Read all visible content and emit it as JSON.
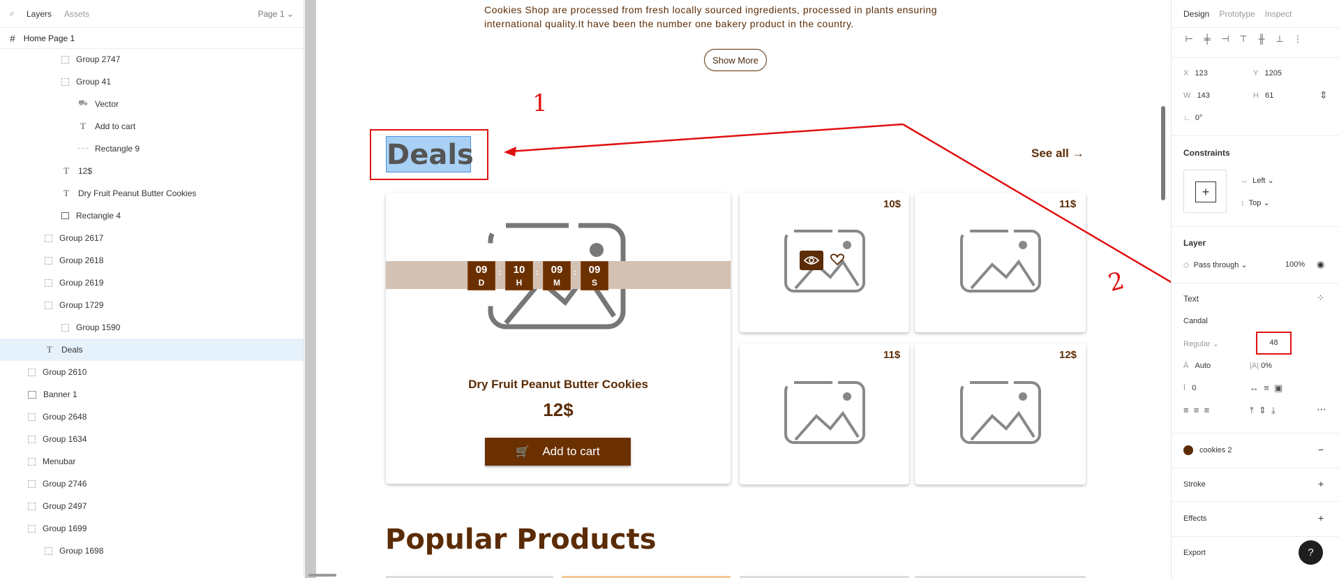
{
  "left_panel": {
    "tabs": {
      "layers": "Layers",
      "assets": "Assets",
      "page": "Page 1 ⌄"
    },
    "page_row": "Home Page 1",
    "layers": [
      {
        "label": "Group 2747",
        "kind": "group",
        "indent": 2
      },
      {
        "label": "Group 41",
        "kind": "group",
        "indent": 2
      },
      {
        "label": "Vector",
        "kind": "vector",
        "indent": 3
      },
      {
        "label": "Add to cart",
        "kind": "text",
        "indent": 3
      },
      {
        "label": "Rectangle 9",
        "kind": "rect9",
        "indent": 3
      },
      {
        "label": "12$",
        "kind": "text",
        "indent": 2
      },
      {
        "label": "Dry Fruit Peanut Butter Cookies",
        "kind": "text",
        "indent": 2
      },
      {
        "label": "Rectangle 4",
        "kind": "rect",
        "indent": 2
      },
      {
        "label": "Group 2617",
        "kind": "group",
        "indent": 1
      },
      {
        "label": "Group 2618",
        "kind": "group",
        "indent": 1
      },
      {
        "label": "Group 2619",
        "kind": "group",
        "indent": 1
      },
      {
        "label": "Group 1729",
        "kind": "group",
        "indent": 1
      },
      {
        "label": "Group 1590",
        "kind": "group",
        "indent": 2
      },
      {
        "label": "Deals",
        "kind": "text",
        "indent": 1,
        "selected": true
      },
      {
        "label": "Group 2610",
        "kind": "group",
        "indent": 0
      },
      {
        "label": "Banner 1",
        "kind": "image",
        "indent": 0
      },
      {
        "label": "Group 2648",
        "kind": "group",
        "indent": 0
      },
      {
        "label": "Group 1634",
        "kind": "group",
        "indent": 0
      },
      {
        "label": "Menubar",
        "kind": "group",
        "indent": 0
      },
      {
        "label": "Group 2746",
        "kind": "group",
        "indent": 0
      },
      {
        "label": "Group 2497",
        "kind": "group",
        "indent": 0
      },
      {
        "label": "Group 1699",
        "kind": "group",
        "indent": 0
      },
      {
        "label": "Group 1698",
        "kind": "group",
        "indent": 1
      }
    ]
  },
  "canvas": {
    "intro_text": "Cookies Shop are processed from fresh locally sourced ingredients, processed in plants ensuring international quality.It have been the number one bakery product in the country.",
    "show_more": "Show More",
    "deals_title": "Deals",
    "see_all": "See all →",
    "featured": {
      "name": "Dry Fruit Peanut Butter Cookies",
      "price": "12$",
      "add_to_cart": "Add to cart",
      "countdown": [
        {
          "value": "09",
          "unit": "D"
        },
        {
          "value": "10",
          "unit": "H"
        },
        {
          "value": "09",
          "unit": "M"
        },
        {
          "value": "09",
          "unit": "S"
        }
      ],
      "separator": ":"
    },
    "small_cards": [
      {
        "price": "10$"
      },
      {
        "price": "11$"
      },
      {
        "price": "11$"
      },
      {
        "price": "12$"
      }
    ],
    "popular_title": "Popular Products",
    "annotations": {
      "one": "1",
      "two": "2"
    },
    "colors": {
      "brown": "#5b2c06",
      "button_brown": "#6b3000",
      "band": "#d3c1b4",
      "annotation_red": "#e01010"
    }
  },
  "right_panel": {
    "tabs": {
      "design": "Design",
      "prototype": "Prototype",
      "inspect": "Inspect"
    },
    "x_label": "X",
    "x": "123",
    "y_label": "Y",
    "y": "1205",
    "w_label": "W",
    "w": "143",
    "h_label": "H",
    "h": "61",
    "rotation": "0°",
    "constraints_title": "Constraints",
    "constraint_h": "Left ⌄",
    "constraint_v": "Top ⌄",
    "layer_title": "Layer",
    "blend": "Pass through ⌄",
    "opacity": "100%",
    "text_title": "Text",
    "font_family": "Candal",
    "font_weight": "Regular ⌄",
    "font_size": "48",
    "line_height": "Auto",
    "letter_spacing": "0%",
    "paragraph_spacing": "0",
    "fill_name": "cookies 2",
    "stroke_title": "Stroke",
    "effects_title": "Effects",
    "export_title": "Export",
    "help": "?"
  }
}
